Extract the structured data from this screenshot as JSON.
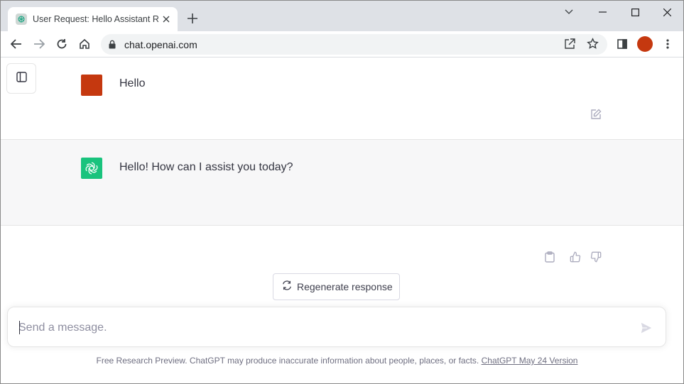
{
  "browser": {
    "tab_title": "User Request: Hello Assistant Res",
    "url": "chat.openai.com",
    "profile_color": "#c5380f"
  },
  "chat": {
    "messages": [
      {
        "role": "user",
        "text": "Hello",
        "avatar_color": "#c5380f"
      },
      {
        "role": "assistant",
        "text": "Hello! How can I assist you today?",
        "avatar_color": "#19c37d"
      }
    ],
    "regenerate_label": "Regenerate response",
    "input_placeholder": "Send a message."
  },
  "footer": {
    "text": "Free Research Preview. ChatGPT may produce inaccurate information about people, places, or facts.",
    "link": "ChatGPT May 24 Version"
  },
  "icons": [
    "chatgpt-favicon-icon",
    "close-icon",
    "plus-icon",
    "chevron-down-icon",
    "minimize-icon",
    "maximize-icon",
    "close-window-icon",
    "back-arrow-icon",
    "forward-arrow-icon",
    "reload-icon",
    "home-icon",
    "lock-icon",
    "share-icon",
    "star-icon",
    "side-panel-icon",
    "kebab-menu-icon",
    "sidebar-toggle-icon",
    "edit-icon",
    "openai-logo-icon",
    "clipboard-icon",
    "thumbs-up-icon",
    "thumbs-down-icon",
    "refresh-icon",
    "send-icon"
  ]
}
